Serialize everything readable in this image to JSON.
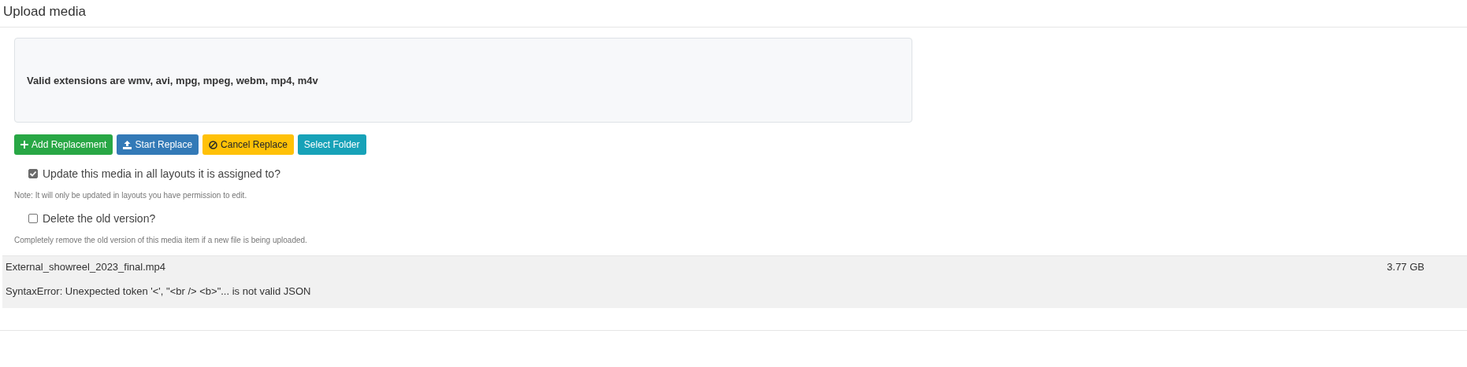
{
  "title": "Upload media",
  "dropzone": {
    "text": "Valid extensions are wmv, avi, mpg, mpeg, webm, mp4, m4v"
  },
  "buttons": [
    {
      "label": "Add Replacement",
      "kind": "add"
    },
    {
      "label": "Start Replace",
      "kind": "start"
    },
    {
      "label": "Cancel Replace",
      "kind": "cancel"
    },
    {
      "label": "Select Folder",
      "kind": "select"
    }
  ],
  "options": [
    {
      "label": "Update this media in all layouts it is assigned to?",
      "checked": true,
      "note": "Note: It will only be updated in layouts you have permission to edit."
    },
    {
      "label": "Delete the old version?",
      "checked": false,
      "note": "Completely remove the old version of this media item if a new file is being uploaded."
    }
  ],
  "files": [
    {
      "name": "External_showreel_2023_final.mp4",
      "size": "3.77 GB",
      "error": "SyntaxError: Unexpected token '<', \"<br /> <b>\"... is not valid JSON"
    }
  ]
}
